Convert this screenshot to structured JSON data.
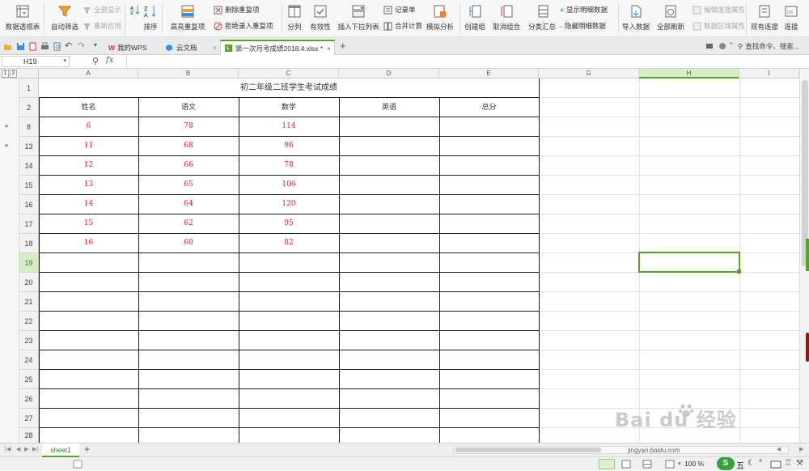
{
  "ribbon": {
    "pivot_table": "数据透视表",
    "auto_filter": "自动筛选",
    "show_all": "全部显示",
    "reapply": "重新应用",
    "sort": "排序",
    "highlight_dup": "高亮重复项",
    "delete_dup": "删除重复项",
    "reject_dup": "拒绝录入重复项",
    "split_col": "分列",
    "validity": "有效性",
    "insert_dropdown": "插入下拉列表",
    "record_form": "记录单",
    "consolidate": "合并计算",
    "what_if": "模拟分析",
    "create_group": "创建组",
    "ungroup": "取消组合",
    "subtotal": "分类汇总",
    "show_detail": "显示明细数据",
    "hide_detail": "隐藏明细数据",
    "import_data": "导入数据",
    "refresh_all": "全部刷新",
    "edit_conn": "编辑连接属性",
    "data_range": "数据区域属性",
    "existing_conn": "现有连接",
    "connect": "连接"
  },
  "tabs": {
    "my_wps": "我的WPS",
    "cloud_docs": "云文档",
    "active_file": "第一次月考成绩2018.4.xlsx *",
    "search_cmd": "查找命令、搜索..."
  },
  "formula_bar": {
    "cell_ref": "H19",
    "fx": "fx",
    "value": ""
  },
  "outline_levels": [
    "1",
    "2"
  ],
  "columns": [
    "A",
    "B",
    "C",
    "D",
    "E",
    "G",
    "H",
    "I"
  ],
  "selected_column": "H",
  "rows": [
    "1",
    "2",
    "8",
    "13",
    "14",
    "15",
    "16",
    "17",
    "18",
    "19",
    "20",
    "21",
    "22",
    "23",
    "24",
    "25",
    "26",
    "27",
    "28"
  ],
  "selected_row": "19",
  "sheet": {
    "title": "初二年级二班学生考试成绩",
    "headers": [
      "姓名",
      "语文",
      "数学",
      "英语",
      "总分"
    ],
    "data": [
      [
        "6",
        "78",
        "114",
        "",
        ""
      ],
      [
        "11",
        "68",
        "96",
        "",
        ""
      ],
      [
        "12",
        "66",
        "78",
        "",
        ""
      ],
      [
        "13",
        "65",
        "106",
        "",
        ""
      ],
      [
        "14",
        "64",
        "120",
        "",
        ""
      ],
      [
        "15",
        "62",
        "95",
        "",
        ""
      ],
      [
        "16",
        "60",
        "82",
        "",
        ""
      ]
    ]
  },
  "sheet_tabs": [
    "sheet1"
  ],
  "status": {
    "zoom": "100 %",
    "ime": "五"
  },
  "watermark": {
    "brand": "Bai du 经验",
    "url": "jingyan.baidu.com"
  },
  "colors": {
    "accent_green": "#5aa02c",
    "data_red": "#e02020"
  }
}
